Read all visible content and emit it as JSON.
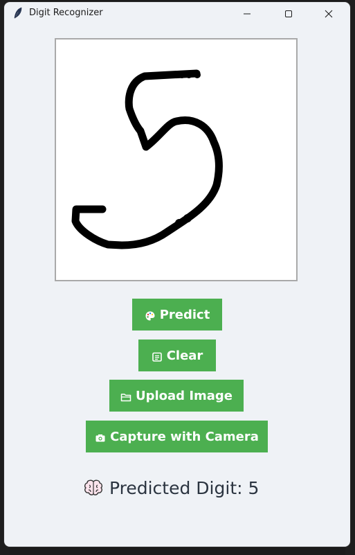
{
  "window": {
    "title": "Digit Recognizer",
    "icon": "feather-icon"
  },
  "titlebar_controls": [
    "minimize-icon",
    "maximize-icon",
    "close-icon"
  ],
  "canvas": {
    "content": "hand-drawn digit",
    "background": "#ffffff"
  },
  "buttons": {
    "predict": {
      "label": "Predict",
      "icon": "palette-icon"
    },
    "clear": {
      "label": "Clear",
      "icon": "clear-icon"
    },
    "upload": {
      "label": "Upload Image",
      "icon": "folder-icon"
    },
    "camera": {
      "label": "Capture with Camera",
      "icon": "camera-icon"
    }
  },
  "result": {
    "text": "Predicted Digit: 5",
    "icon": "brain-icon"
  },
  "colors": {
    "button_green": "#4caf50",
    "window_bg": "#eff2f6",
    "result_text": "#2b3440"
  }
}
